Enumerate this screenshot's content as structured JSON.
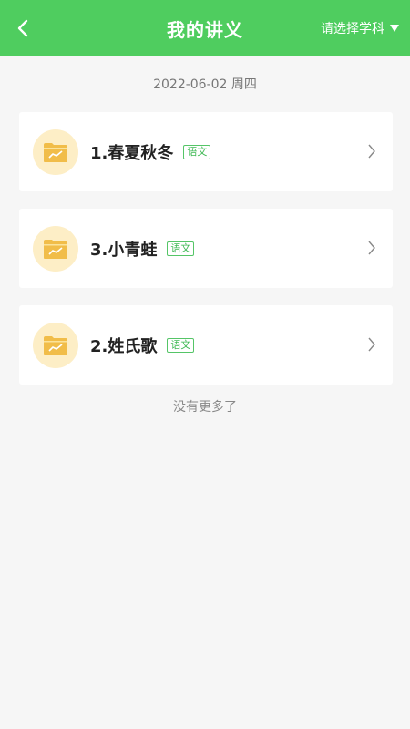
{
  "header": {
    "title": "我的讲义",
    "subject_select": "请选择学科"
  },
  "date": "2022-06-02 周四",
  "items": [
    {
      "title": "1.春夏秋冬",
      "tag": "语文"
    },
    {
      "title": "3.小青蛙",
      "tag": "语文"
    },
    {
      "title": "2.姓氏歌",
      "tag": "语文"
    }
  ],
  "footer": "没有更多了",
  "colors": {
    "header_bg": "#4fcd5f",
    "tag_green": "#3fb954",
    "folder_bg": "#fdeec6",
    "folder_icon": "#f1bd49"
  },
  "icons": [
    "chevron-left-icon",
    "caret-down-icon",
    "folder-chart-icon",
    "chevron-right-icon"
  ]
}
